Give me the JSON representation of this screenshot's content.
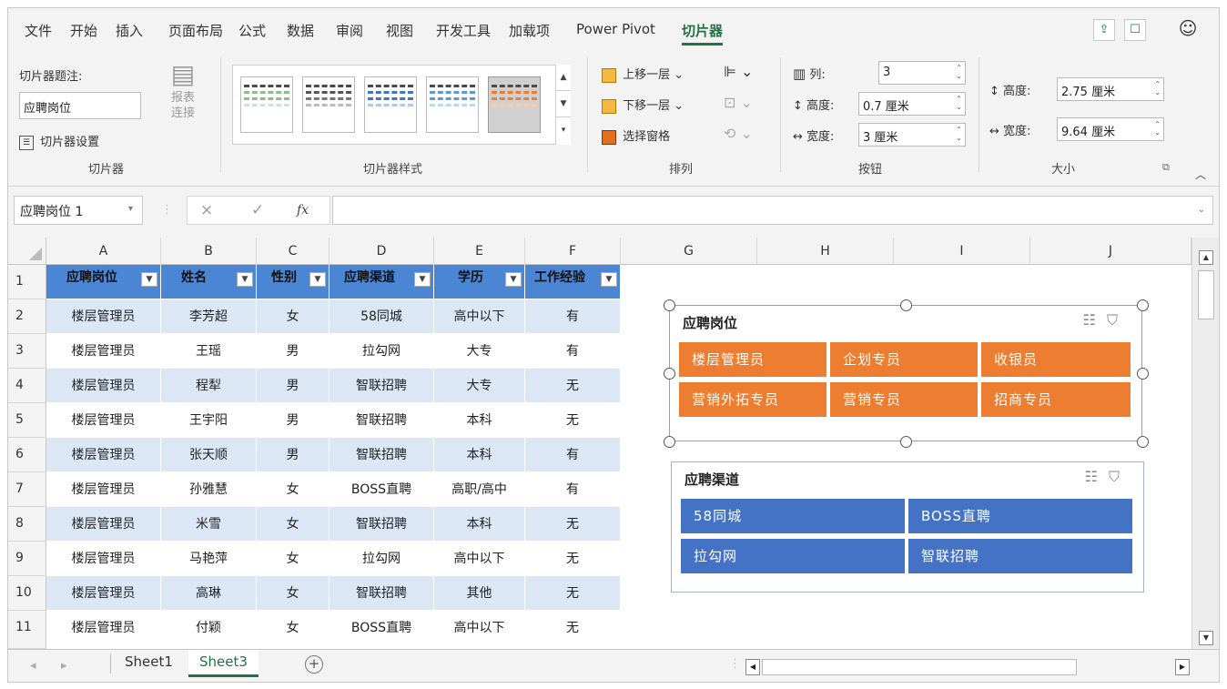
{
  "menu_tabs": [
    "文件",
    "开始",
    "插入",
    "页面布局",
    "公式",
    "数据",
    "审阅",
    "视图",
    "开发工具",
    "加载项",
    "Power Pivot",
    "切片器"
  ],
  "ribbon": {
    "caption_label": "切片器题注:",
    "caption_value": "应聘岗位",
    "settings_label": "切片器设置",
    "report_label": "报表\n连接",
    "group_slicer": "切片器",
    "group_styles": "切片器样式",
    "bring_forward": "上移一层",
    "send_backward": "下移一层",
    "selection_pane": "选择窗格",
    "group_arrange": "排列",
    "columns_label": "列:",
    "columns_value": "3",
    "btn_height_label": "高度:",
    "btn_height_value": "0.7 厘米",
    "btn_width_label": "宽度:",
    "btn_width_value": "3 厘米",
    "group_buttons": "按钮",
    "size_height_label": "高度:",
    "size_height_value": "2.75 厘米",
    "size_width_label": "宽度:",
    "size_width_value": "9.64 厘米",
    "group_size": "大小"
  },
  "formula_bar": {
    "name_box": "应聘岗位 1",
    "fx": "fx",
    "cancel": "×",
    "enter": "✓"
  },
  "columns": [
    "A",
    "B",
    "C",
    "D",
    "E",
    "F",
    "G",
    "H",
    "I",
    "J"
  ],
  "rows": [
    "1",
    "2",
    "3",
    "4",
    "5",
    "6",
    "7",
    "8",
    "9",
    "10",
    "11"
  ],
  "table_headers": [
    "应聘岗位",
    "姓名",
    "性别",
    "应聘渠道",
    "学历",
    "工作经验"
  ],
  "table_rows": [
    [
      "楼层管理员",
      "李芳超",
      "女",
      "58同城",
      "高中以下",
      "有"
    ],
    [
      "楼层管理员",
      "王瑶",
      "男",
      "拉勾网",
      "大专",
      "有"
    ],
    [
      "楼层管理员",
      "程犁",
      "男",
      "智联招聘",
      "大专",
      "无"
    ],
    [
      "楼层管理员",
      "王宇阳",
      "男",
      "智联招聘",
      "本科",
      "无"
    ],
    [
      "楼层管理员",
      "张天顺",
      "男",
      "智联招聘",
      "本科",
      "有"
    ],
    [
      "楼层管理员",
      "孙雅慧",
      "女",
      "BOSS直聘",
      "高职/高中",
      "有"
    ],
    [
      "楼层管理员",
      "米雪",
      "女",
      "智联招聘",
      "本科",
      "无"
    ],
    [
      "楼层管理员",
      "马艳萍",
      "女",
      "拉勾网",
      "高中以下",
      "无"
    ],
    [
      "楼层管理员",
      "高琳",
      "女",
      "智联招聘",
      "其他",
      "无"
    ],
    [
      "楼层管理员",
      "付颖",
      "女",
      "BOSS直聘",
      "高中以下",
      "无"
    ]
  ],
  "slicer_position": {
    "title": "应聘岗位",
    "items": [
      "楼层管理员",
      "企划专员",
      "收银员",
      "营销外拓专员",
      "营销专员",
      "招商专员"
    ]
  },
  "slicer_channel": {
    "title": "应聘渠道",
    "items": [
      "58同城",
      "BOSS直聘",
      "拉勾网",
      "智联招聘"
    ]
  },
  "sheets": [
    "Sheet1",
    "Sheet3"
  ],
  "active_sheet": "Sheet3",
  "colors": {
    "header_blue": "#4a86d4",
    "band_blue": "#dbe7f5",
    "slicer_orange": "#ed7d31",
    "slicer_blue": "#4472c4",
    "excel_green": "#217346"
  }
}
